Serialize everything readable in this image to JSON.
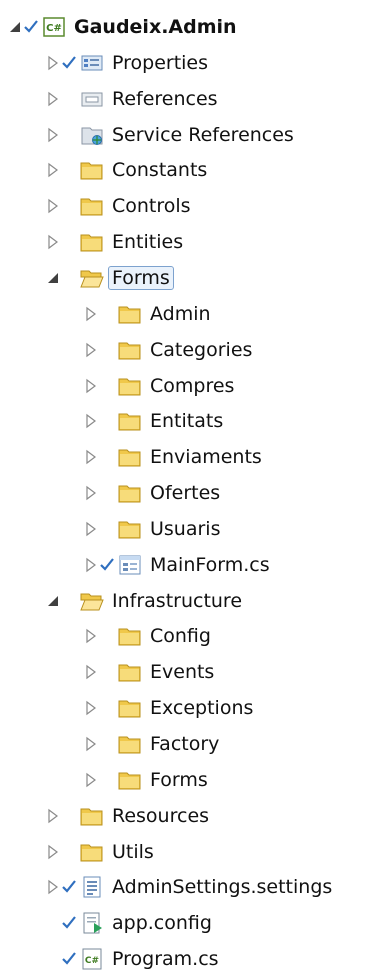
{
  "tree": [
    {
      "id": "gaudeix-admin",
      "label": "Gaudeix.Admin",
      "depth": 0,
      "expander": "expanded",
      "checked": true,
      "icon": "csharp-project-icon",
      "bold": true
    },
    {
      "id": "properties",
      "label": "Properties",
      "depth": 1,
      "expander": "collapsed",
      "checked": true,
      "icon": "properties-icon"
    },
    {
      "id": "references",
      "label": "References",
      "depth": 1,
      "expander": "collapsed",
      "checked": false,
      "icon": "references-icon"
    },
    {
      "id": "service-references",
      "label": "Service References",
      "depth": 1,
      "expander": "collapsed",
      "checked": false,
      "icon": "service-references-icon"
    },
    {
      "id": "constants",
      "label": "Constants",
      "depth": 1,
      "expander": "collapsed",
      "checked": false,
      "icon": "folder-icon"
    },
    {
      "id": "controls",
      "label": "Controls",
      "depth": 1,
      "expander": "collapsed",
      "checked": false,
      "icon": "folder-icon"
    },
    {
      "id": "entities",
      "label": "Entities",
      "depth": 1,
      "expander": "collapsed",
      "checked": false,
      "icon": "folder-icon"
    },
    {
      "id": "forms",
      "label": "Forms",
      "depth": 1,
      "expander": "expanded",
      "checked": false,
      "icon": "folder-open-icon",
      "selected": true
    },
    {
      "id": "admin",
      "label": "Admin",
      "depth": 2,
      "expander": "collapsed",
      "checked": false,
      "icon": "folder-icon"
    },
    {
      "id": "categories",
      "label": "Categories",
      "depth": 2,
      "expander": "collapsed",
      "checked": false,
      "icon": "folder-icon"
    },
    {
      "id": "compres",
      "label": "Compres",
      "depth": 2,
      "expander": "collapsed",
      "checked": false,
      "icon": "folder-icon"
    },
    {
      "id": "entitats",
      "label": "Entitats",
      "depth": 2,
      "expander": "collapsed",
      "checked": false,
      "icon": "folder-icon"
    },
    {
      "id": "enviaments",
      "label": "Enviaments",
      "depth": 2,
      "expander": "collapsed",
      "checked": false,
      "icon": "folder-icon"
    },
    {
      "id": "ofertes",
      "label": "Ofertes",
      "depth": 2,
      "expander": "collapsed",
      "checked": false,
      "icon": "folder-icon"
    },
    {
      "id": "usuaris",
      "label": "Usuaris",
      "depth": 2,
      "expander": "collapsed",
      "checked": false,
      "icon": "folder-icon"
    },
    {
      "id": "mainform-cs",
      "label": "MainForm.cs",
      "depth": 2,
      "expander": "collapsed",
      "checked": true,
      "icon": "form-file-icon"
    },
    {
      "id": "infrastructure",
      "label": "Infrastructure",
      "depth": 1,
      "expander": "expanded",
      "checked": false,
      "icon": "folder-open-icon"
    },
    {
      "id": "config",
      "label": "Config",
      "depth": 2,
      "expander": "collapsed",
      "checked": false,
      "icon": "folder-icon"
    },
    {
      "id": "events",
      "label": "Events",
      "depth": 2,
      "expander": "collapsed",
      "checked": false,
      "icon": "folder-icon"
    },
    {
      "id": "exceptions",
      "label": "Exceptions",
      "depth": 2,
      "expander": "collapsed",
      "checked": false,
      "icon": "folder-icon"
    },
    {
      "id": "factory",
      "label": "Factory",
      "depth": 2,
      "expander": "collapsed",
      "checked": false,
      "icon": "folder-icon"
    },
    {
      "id": "forms-2",
      "label": "Forms",
      "depth": 2,
      "expander": "collapsed",
      "checked": false,
      "icon": "folder-icon"
    },
    {
      "id": "resources",
      "label": "Resources",
      "depth": 1,
      "expander": "collapsed",
      "checked": false,
      "icon": "folder-icon"
    },
    {
      "id": "utils",
      "label": "Utils",
      "depth": 1,
      "expander": "collapsed",
      "checked": false,
      "icon": "folder-icon"
    },
    {
      "id": "adminsettings-settings",
      "label": "AdminSettings.settings",
      "depth": 1,
      "expander": "collapsed",
      "checked": true,
      "icon": "settings-file-icon"
    },
    {
      "id": "app-config",
      "label": "app.config",
      "depth": 1,
      "expander": "none",
      "checked": true,
      "icon": "config-file-icon"
    },
    {
      "id": "program-cs",
      "label": "Program.cs",
      "depth": 1,
      "expander": "none",
      "checked": true,
      "icon": "csharp-file-icon"
    }
  ]
}
